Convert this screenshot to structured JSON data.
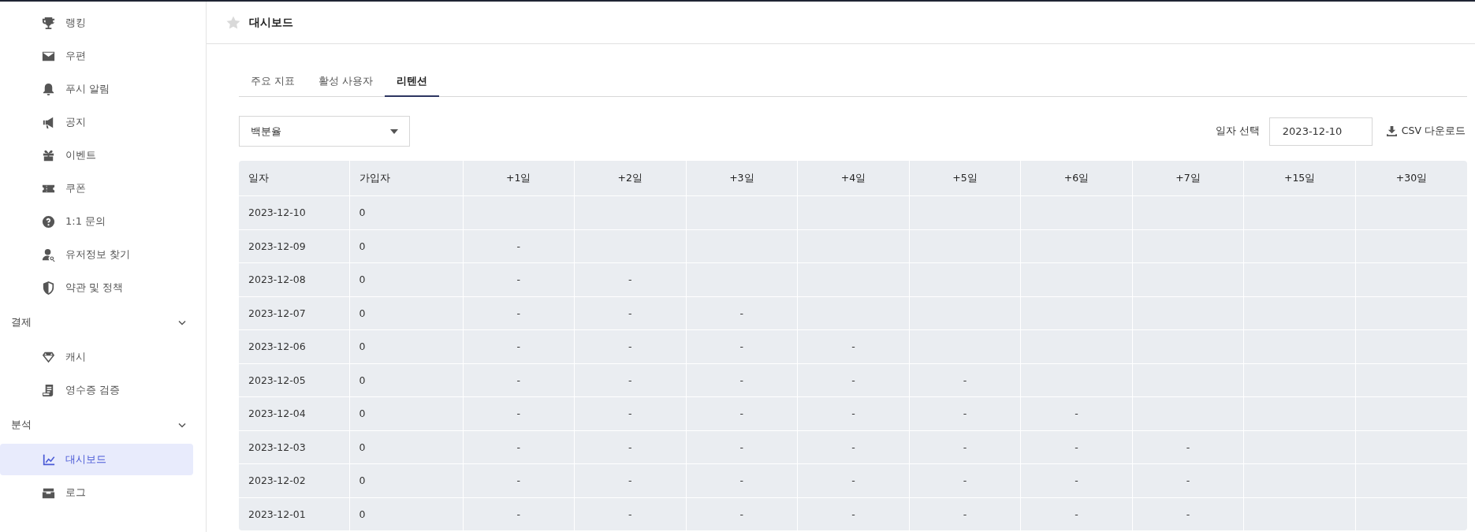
{
  "sidebar": {
    "groups": [
      {
        "items": [
          {
            "label": "랭킹",
            "selected": false
          },
          {
            "label": "우편",
            "selected": false
          },
          {
            "label": "푸시 알림",
            "selected": false
          },
          {
            "label": "공지",
            "selected": false
          },
          {
            "label": "이벤트",
            "selected": false
          },
          {
            "label": "쿠폰",
            "selected": false
          },
          {
            "label": "1:1 문의",
            "selected": false
          },
          {
            "label": "유저정보 찾기",
            "selected": false
          },
          {
            "label": "약관 및 정책",
            "selected": false
          }
        ]
      },
      {
        "title": "결제",
        "expanded": true,
        "items": [
          {
            "label": "캐시",
            "selected": false
          },
          {
            "label": "영수증 검증",
            "selected": false
          }
        ]
      },
      {
        "title": "분석",
        "expanded": true,
        "items": [
          {
            "label": "대시보드",
            "selected": true
          },
          {
            "label": "로그",
            "selected": false
          }
        ]
      }
    ]
  },
  "header": {
    "title": "대시보드",
    "favorite": false
  },
  "tabs": [
    {
      "label": "주요 지표",
      "selected": false
    },
    {
      "label": "활성 사용자",
      "selected": false
    },
    {
      "label": "리텐션",
      "selected": true
    }
  ],
  "mode_select": {
    "value": "백분율"
  },
  "date_picker": {
    "label": "일자 선택",
    "value": "2023-12-10"
  },
  "download_button": {
    "label": "CSV 다운로드"
  },
  "table": {
    "columns": [
      "일자",
      "가입자",
      "+1일",
      "+2일",
      "+3일",
      "+4일",
      "+5일",
      "+6일",
      "+7일",
      "+15일",
      "+30일"
    ],
    "rows": [
      {
        "date": "2023-12-10",
        "signups": "0",
        "retention": []
      },
      {
        "date": "2023-12-09",
        "signups": "0",
        "retention": [
          "-"
        ]
      },
      {
        "date": "2023-12-08",
        "signups": "0",
        "retention": [
          "-",
          "-"
        ]
      },
      {
        "date": "2023-12-07",
        "signups": "0",
        "retention": [
          "-",
          "-",
          "-"
        ]
      },
      {
        "date": "2023-12-06",
        "signups": "0",
        "retention": [
          "-",
          "-",
          "-",
          "-"
        ]
      },
      {
        "date": "2023-12-05",
        "signups": "0",
        "retention": [
          "-",
          "-",
          "-",
          "-",
          "-"
        ]
      },
      {
        "date": "2023-12-04",
        "signups": "0",
        "retention": [
          "-",
          "-",
          "-",
          "-",
          "-",
          "-"
        ]
      },
      {
        "date": "2023-12-03",
        "signups": "0",
        "retention": [
          "-",
          "-",
          "-",
          "-",
          "-",
          "-",
          "-"
        ]
      },
      {
        "date": "2023-12-02",
        "signups": "0",
        "retention": [
          "-",
          "-",
          "-",
          "-",
          "-",
          "-",
          "-"
        ]
      },
      {
        "date": "2023-12-01",
        "signups": "0",
        "retention": [
          "-",
          "-",
          "-",
          "-",
          "-",
          "-",
          "-"
        ]
      }
    ]
  }
}
